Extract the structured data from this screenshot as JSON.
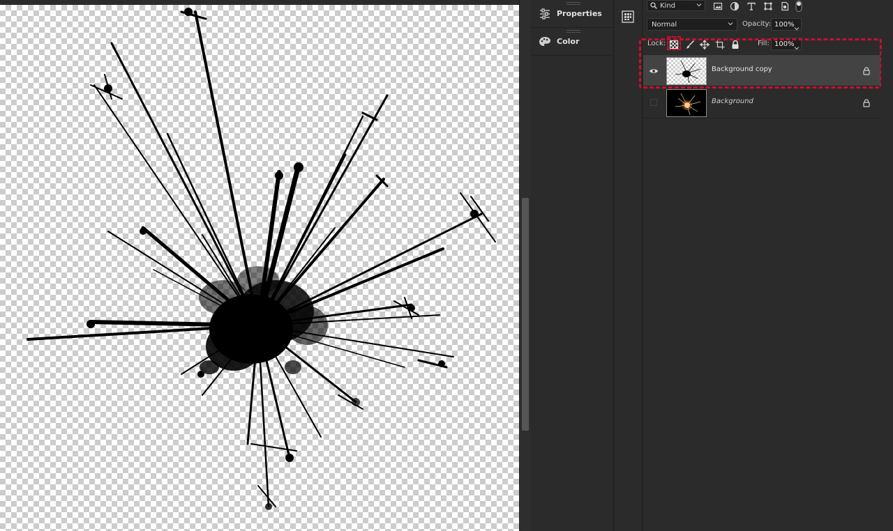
{
  "panel_dock": {
    "items": [
      {
        "label": "Properties",
        "icon": "properties-sliders-icon"
      },
      {
        "label": "Color",
        "icon": "color-palette-icon"
      }
    ]
  },
  "icon_strip": {
    "items": [
      {
        "icon": "libraries-grid-icon"
      }
    ]
  },
  "layers": {
    "filter": {
      "kind_label": "Kind",
      "filter_icons": [
        "pixel-filter-icon",
        "adjustment-filter-icon",
        "type-filter-icon",
        "shape-filter-icon",
        "smart-object-filter-icon",
        "filter-toggle-icon"
      ]
    },
    "blend_mode": "Normal",
    "opacity_label": "Opacity:",
    "opacity_value": "100%",
    "lock_label": "Lock:",
    "lock_icons": [
      "lock-transparent-pixels-icon",
      "lock-image-pixels-icon",
      "lock-position-icon",
      "lock-artboard-icon",
      "lock-all-icon"
    ],
    "fill_label": "Fill:",
    "fill_value": "100%",
    "list": [
      {
        "name": "Background copy",
        "visible": true,
        "selected": true,
        "locked": true
      },
      {
        "name": "Background",
        "visible": false,
        "selected": false,
        "locked": true
      }
    ]
  },
  "colors": {
    "highlight": "#c8102e",
    "panel_bg": "#2b2b2b",
    "selected_row": "#434343"
  }
}
